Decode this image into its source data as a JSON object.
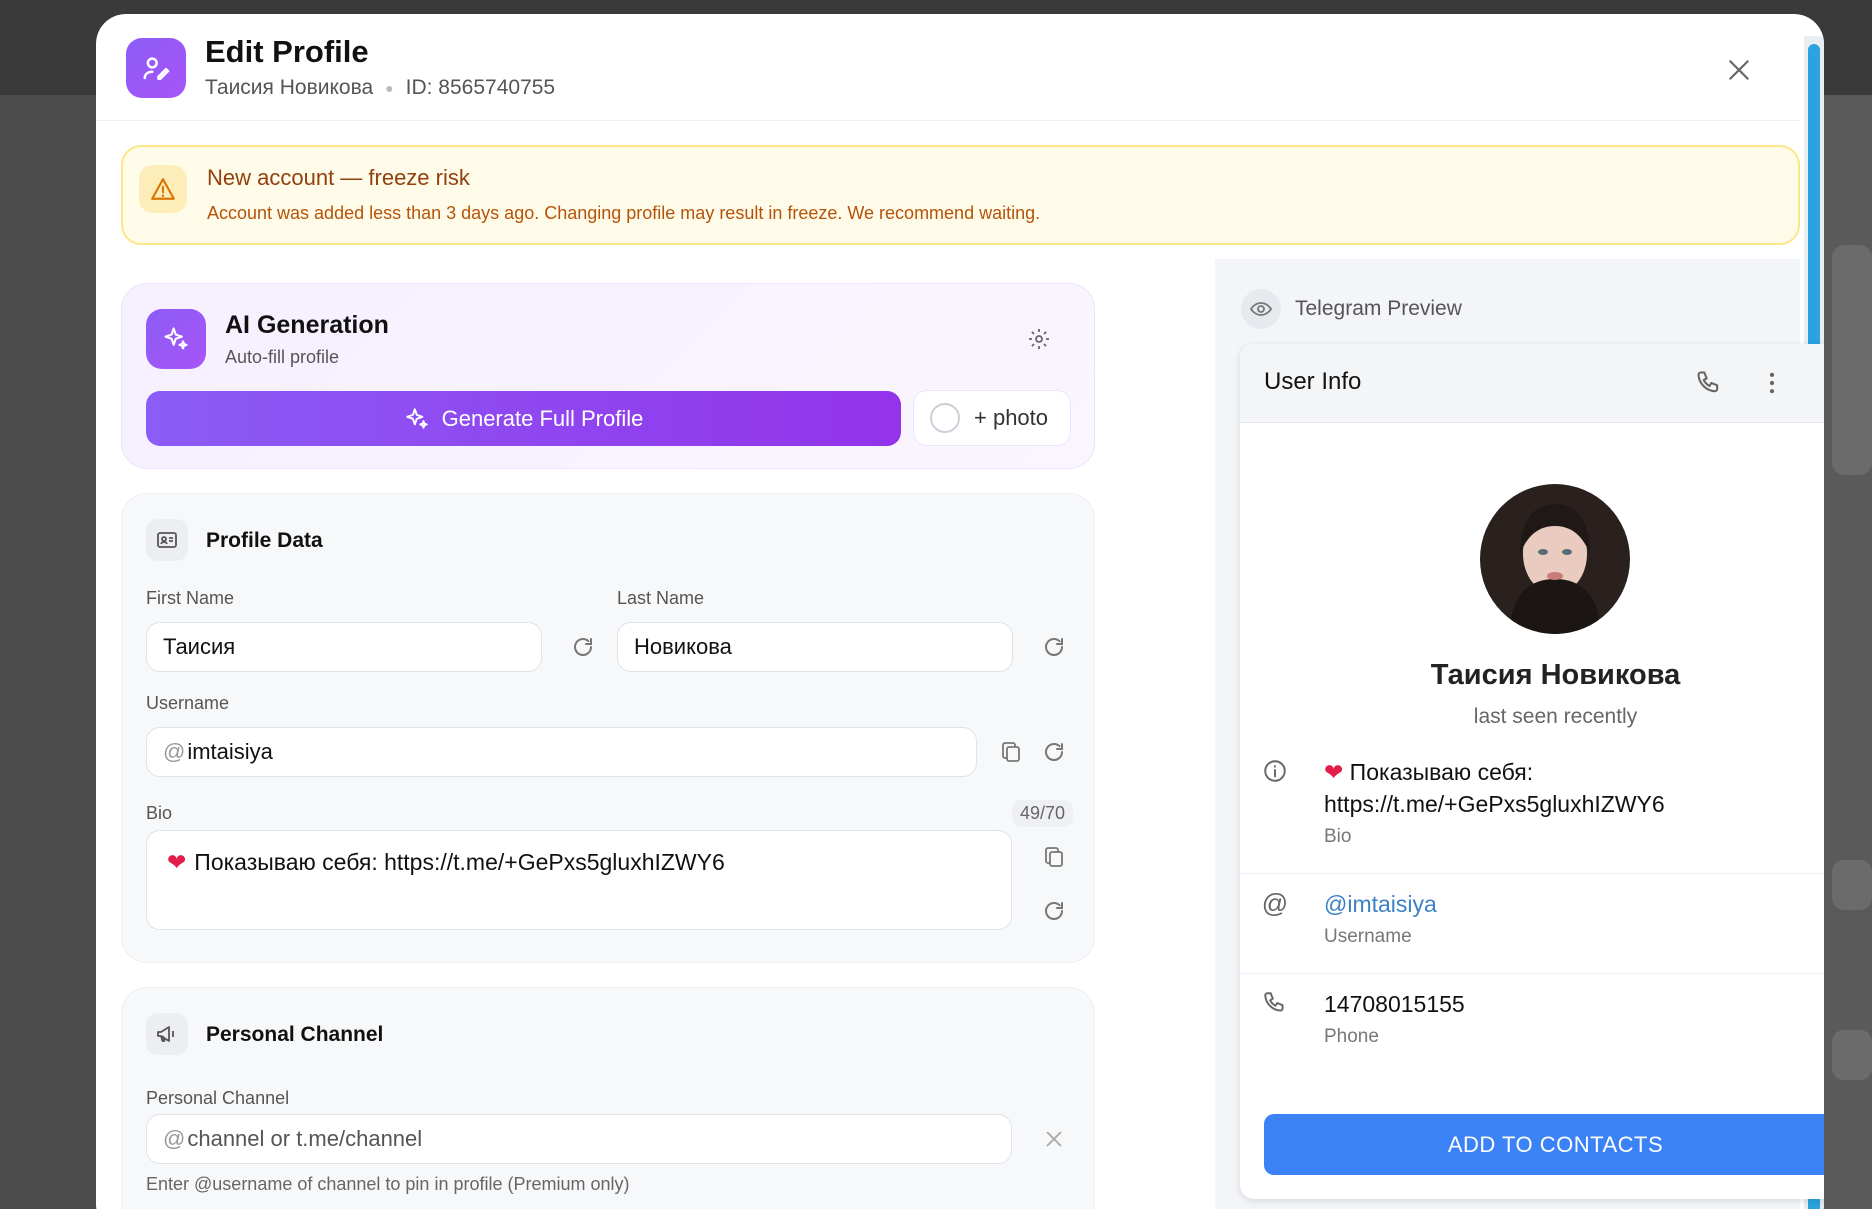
{
  "header": {
    "title": "Edit Profile",
    "account_name": "Таисия Новикова",
    "account_id": "ID: 8565740755"
  },
  "warning": {
    "title": "New account — freeze risk",
    "text": "Account was added less than 3 days ago. Changing profile may result in freeze. We recommend waiting."
  },
  "ai": {
    "title": "AI Generation",
    "subtitle": "Auto-fill profile",
    "generate_label": "Generate Full Profile",
    "photo_label": "+ photo"
  },
  "profile": {
    "section_title": "Profile Data",
    "first_name_label": "First Name",
    "first_name_value": "Таисия",
    "last_name_label": "Last Name",
    "last_name_value": "Новикова",
    "username_label": "Username",
    "username_value": "imtaisiya",
    "bio_label": "Bio",
    "bio_counter": "49/70",
    "bio_value": "Показываю себя: https://t.me/+GePxs5gluxhIZWY6"
  },
  "channel": {
    "section_title": "Personal Channel",
    "field_label": "Personal Channel",
    "placeholder": "channel or t.me/channel",
    "hint": "Enter @username of channel to pin in profile (Premium only)"
  },
  "preview": {
    "title": "Telegram Preview",
    "card_title": "User Info",
    "name": "Таисия Новикова",
    "status": "last seen recently",
    "bio_line1": "Показываю себя:",
    "bio_line2": "https://t.me/+GePxs5gluxhIZWY6",
    "bio_caption": "Bio",
    "username": "@imtaisiya",
    "username_caption": "Username",
    "phone": "14708015155",
    "phone_caption": "Phone",
    "add_button": "ADD TO CONTACTS"
  },
  "colors": {
    "accent_purple": "#8b5cf6",
    "telegram_blue": "#3b82f6",
    "warning_bg": "#fffbe9",
    "scrollbar": "#2aa3e0"
  }
}
